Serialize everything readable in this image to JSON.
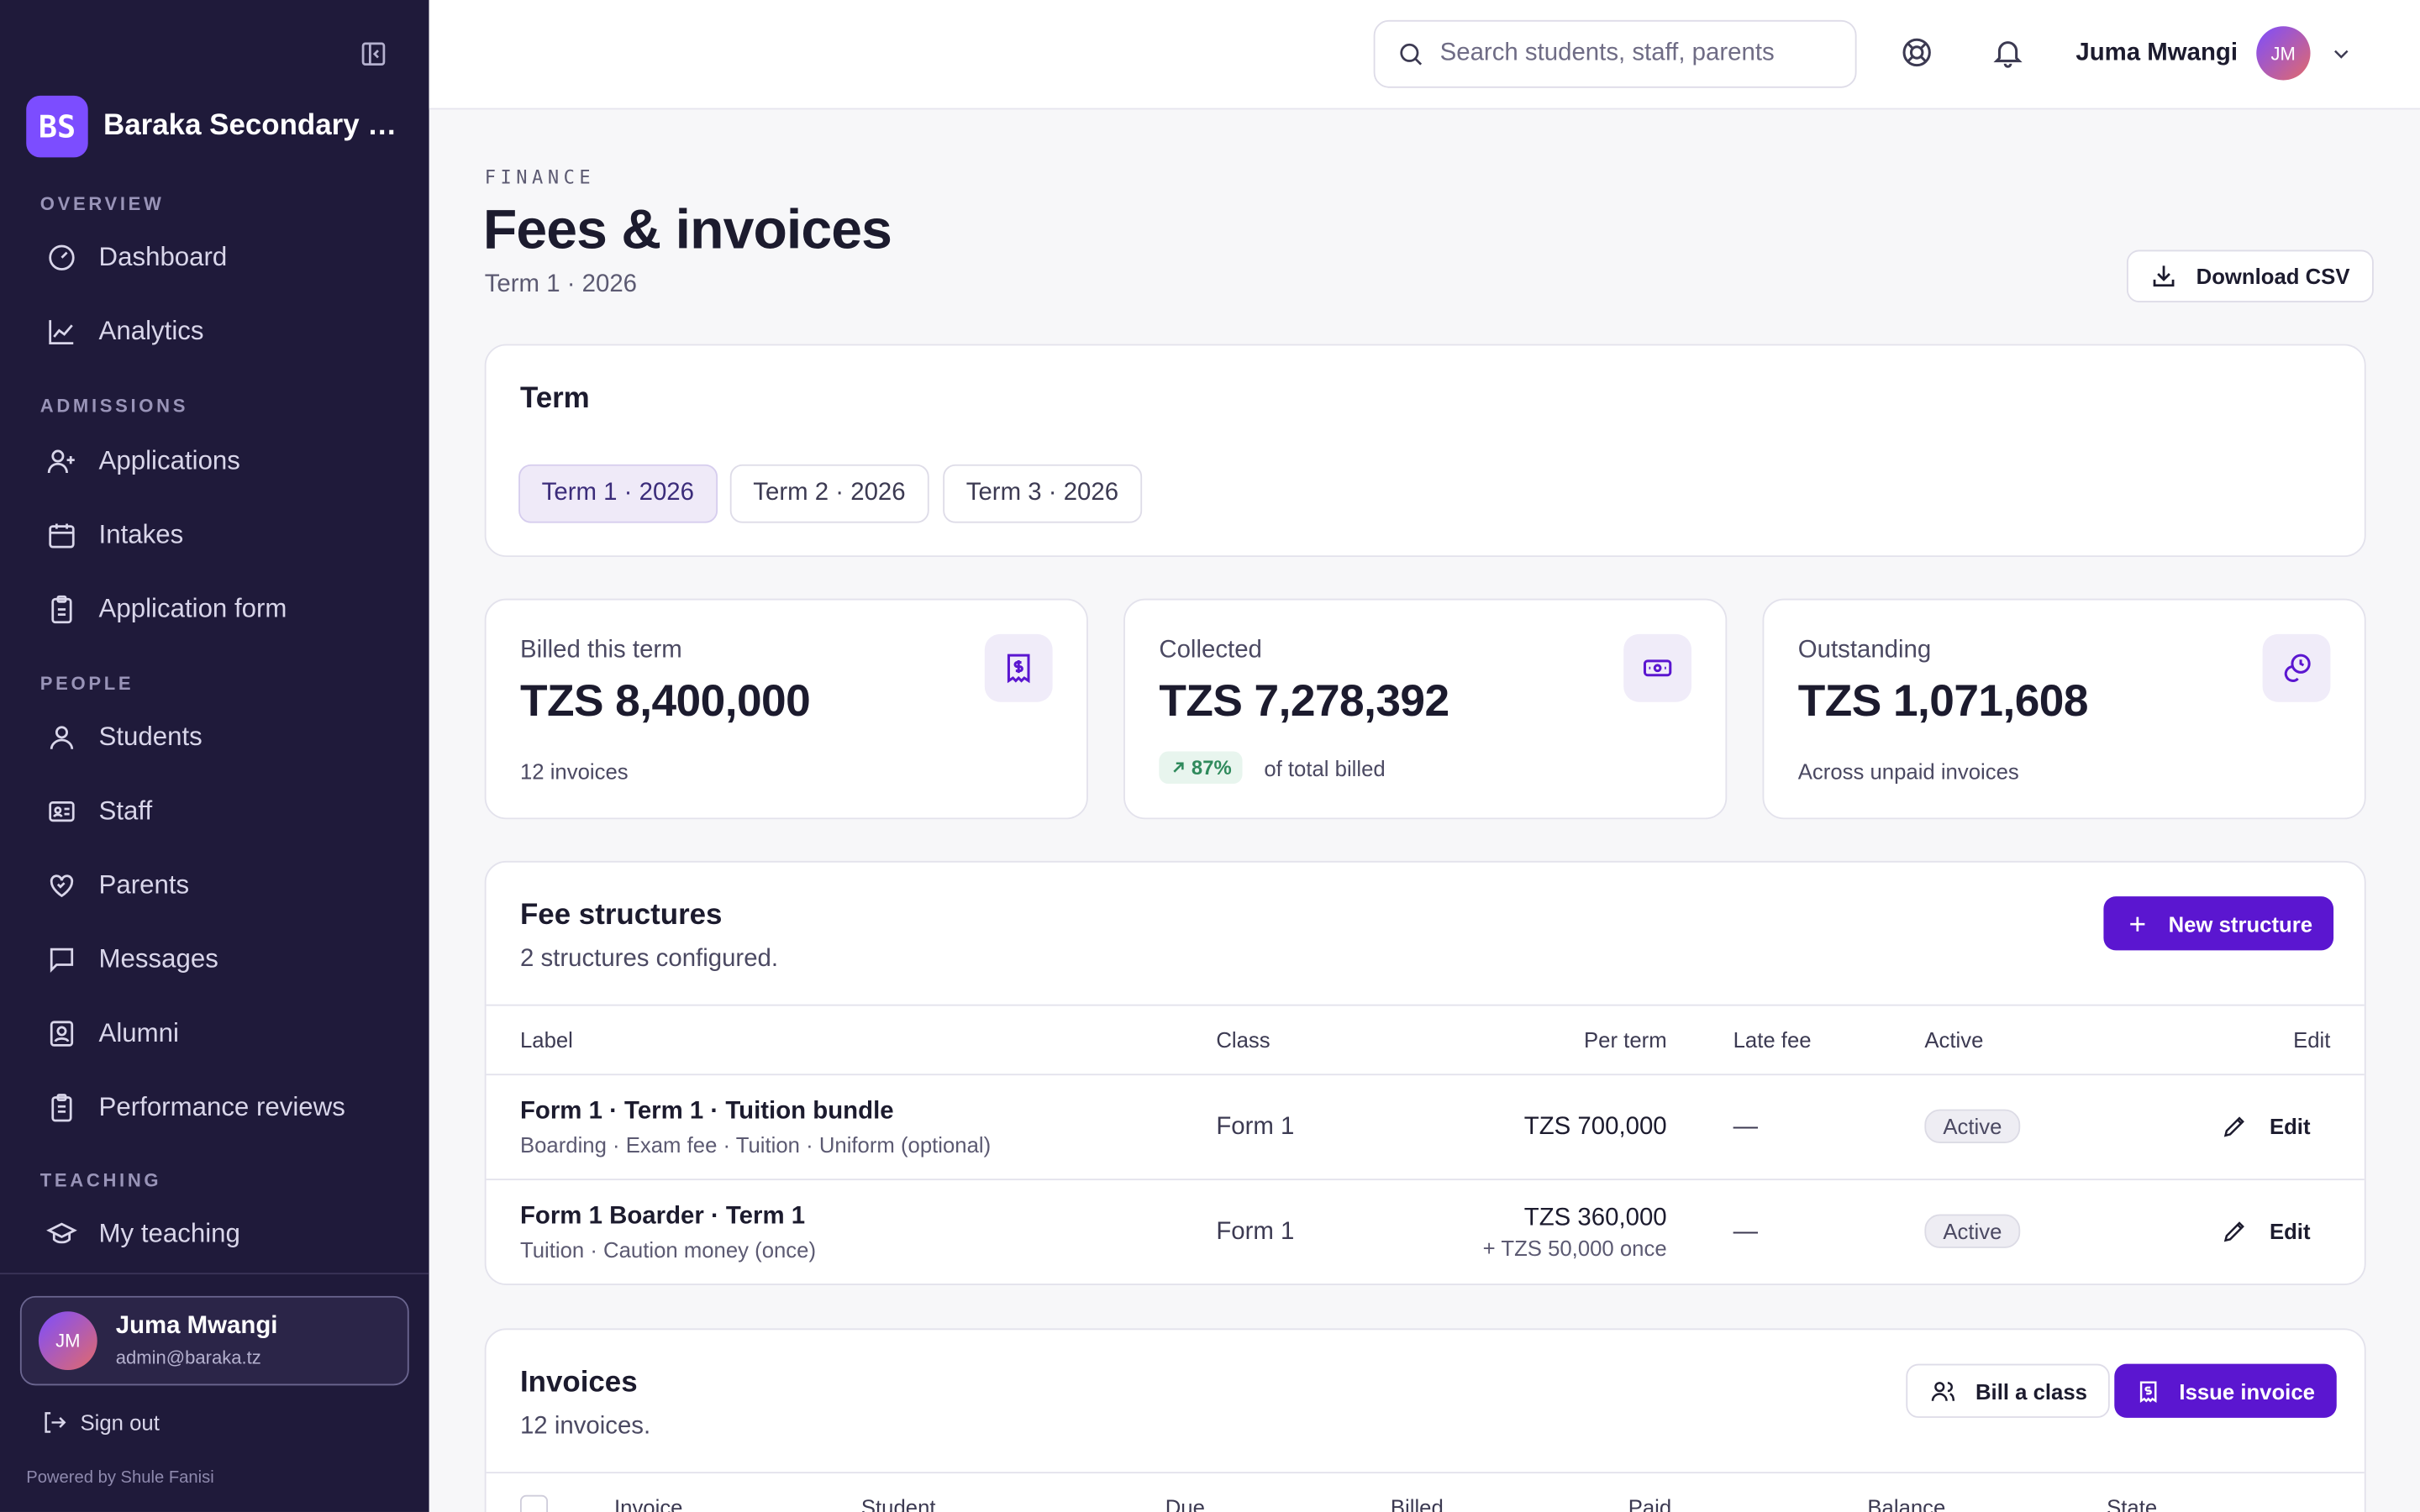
{
  "sidebar": {
    "brand_initials": "BS",
    "brand_name": "Baraka Secondary School",
    "sections": {
      "overview": "OVERVIEW",
      "admissions": "ADMISSIONS",
      "people": "PEOPLE",
      "teaching": "TEACHING"
    },
    "items": {
      "dashboard": "Dashboard",
      "analytics": "Analytics",
      "applications": "Applications",
      "intakes": "Intakes",
      "application_form": "Application form",
      "students": "Students",
      "staff": "Staff",
      "parents": "Parents",
      "messages": "Messages",
      "alumni": "Alumni",
      "performance_reviews": "Performance reviews",
      "my_teaching": "My teaching"
    },
    "user": {
      "initials": "JM",
      "name": "Juma Mwangi",
      "email": "admin@baraka.tz"
    },
    "sign_out": "Sign out",
    "powered_by": "Powered by Shule Fanisi"
  },
  "topbar": {
    "search_placeholder": "Search students, staff, parents",
    "user_name": "Juma Mwangi",
    "user_initials": "JM"
  },
  "header": {
    "eyebrow": "FINANCE",
    "title": "Fees & invoices",
    "subtitle": "Term 1 · 2026",
    "download_label": "Download CSV"
  },
  "term_card": {
    "title": "Term",
    "terms": [
      "Term 1 · 2026",
      "Term 2 · 2026",
      "Term 3 · 2026"
    ],
    "selected": "Term 1 · 2026"
  },
  "stats": {
    "billed": {
      "label": "Billed this term",
      "value": "TZS 8,400,000",
      "foot": "12 invoices"
    },
    "collected": {
      "label": "Collected",
      "value": "TZS 7,278,392",
      "pct": "87%",
      "foot": "of total billed"
    },
    "outstanding": {
      "label": "Outstanding",
      "value": "TZS 1,071,608",
      "foot": "Across unpaid invoices"
    }
  },
  "fee_structures": {
    "title": "Fee structures",
    "subtitle": "2 structures configured.",
    "new_label": "New structure",
    "columns": {
      "label": "Label",
      "class": "Class",
      "per_term": "Per term",
      "late_fee": "Late fee",
      "active": "Active",
      "edit": "Edit"
    },
    "rows": [
      {
        "title": "Form 1 · Term 1 · Tuition bundle",
        "items": "Boarding · Exam fee · Tuition · Uniform (optional)",
        "class": "Form 1",
        "per_term": "TZS 700,000",
        "once": "",
        "late_fee": "—",
        "active": "Active",
        "edit": "Edit"
      },
      {
        "title": "Form 1 Boarder · Term 1",
        "items": "Tuition · Caution money (once)",
        "class": "Form 1",
        "per_term": "TZS 360,000",
        "once": "+ TZS 50,000 once",
        "late_fee": "—",
        "active": "Active",
        "edit": "Edit"
      }
    ]
  },
  "invoices": {
    "title": "Invoices",
    "subtitle": "12 invoices.",
    "bill_class_label": "Bill a class",
    "issue_label": "Issue invoice",
    "columns": {
      "invoice": "Invoice",
      "student": "Student",
      "due": "Due",
      "billed": "Billed",
      "paid": "Paid",
      "balance": "Balance",
      "state": "State"
    }
  },
  "colors": {
    "sidebar_bg": "#1f1a3a",
    "accent": "#5b16d0",
    "brand": "#7c4dff",
    "success": "#2f8a5c"
  }
}
